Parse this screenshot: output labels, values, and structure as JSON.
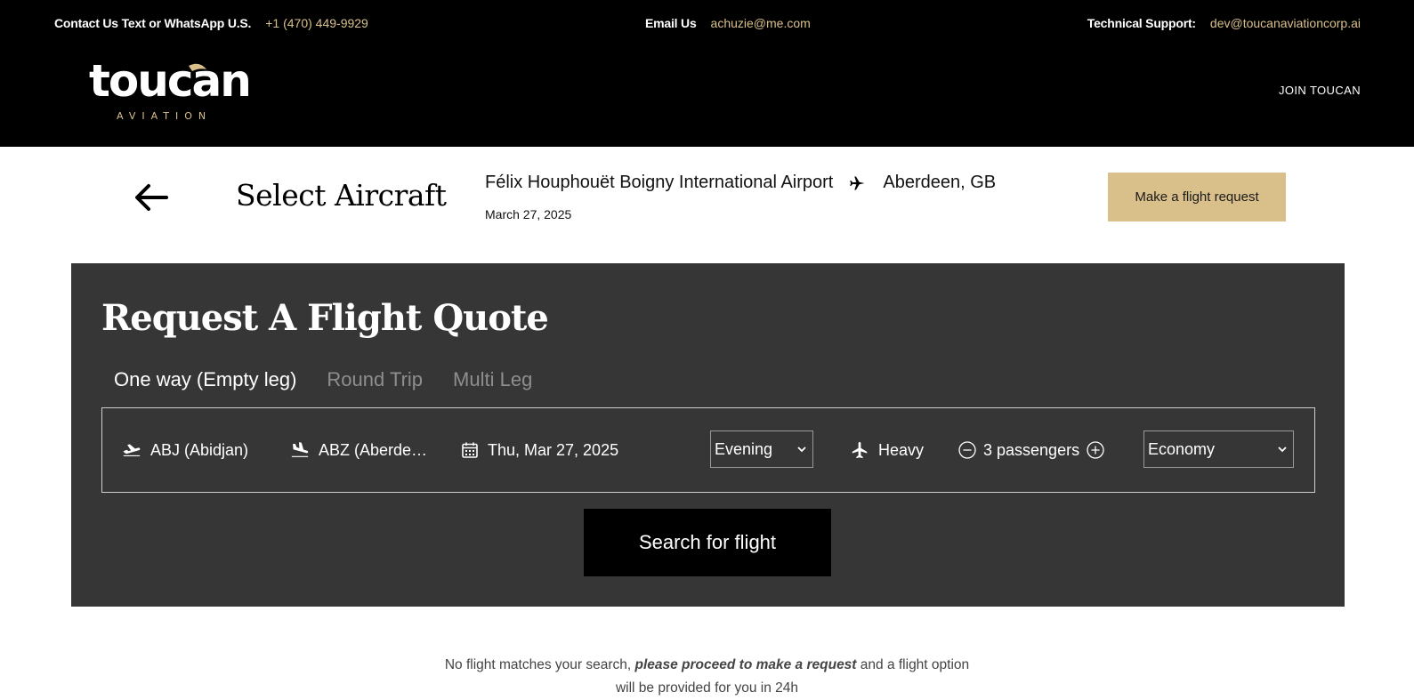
{
  "topbar": {
    "contact_label": "Contact Us Text or WhatsApp U.S.",
    "contact_phone": "+1 (470) 449-9929",
    "email_label": "Email Us",
    "email_value": "achuzie@me.com",
    "support_label": "Technical Support:",
    "support_value": "dev@toucanaviationcorp.ai"
  },
  "logo": {
    "wordmark": "toucan",
    "sub": "AVIATION"
  },
  "nav": {
    "join": "JOIN TOUCAN"
  },
  "selection": {
    "title": "Select Aircraft",
    "origin": "Félix Houphouët Boigny International Airport",
    "destination": "Aberdeen, GB",
    "date": "March 27, 2025",
    "request_button": "Make a flight request"
  },
  "quote": {
    "title": "Request A Flight Quote",
    "tabs": [
      {
        "label": "One way (Empty leg)",
        "active": true
      },
      {
        "label": "Round Trip",
        "active": false
      },
      {
        "label": "Multi Leg",
        "active": false
      }
    ],
    "from": "ABJ (Abidjan)",
    "to": "ABZ (Aberdeen)",
    "date": "Thu, Mar 27, 2025",
    "time_of_day": "Evening",
    "aircraft_size": "Heavy",
    "passengers": "3 passengers",
    "cabin_class": "Economy",
    "search_button": "Search for flight"
  },
  "notice": {
    "before": "No flight matches your search, ",
    "emphasis": "please proceed to make a request",
    "after": " and a flight option",
    "line2": "will be provided for you in 24h"
  },
  "colors": {
    "gold": "#d9c08b",
    "panel": "#363636",
    "header": "#000000"
  }
}
